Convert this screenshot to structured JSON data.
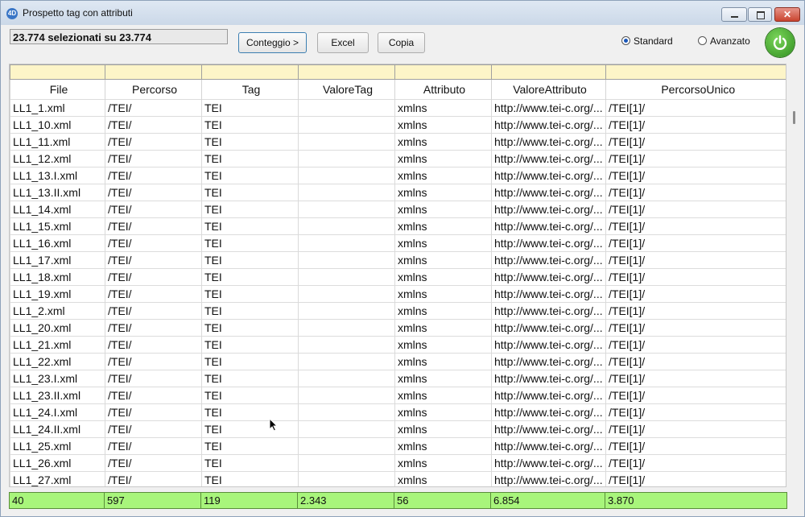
{
  "window": {
    "title": "Prospetto tag con attributi",
    "app_icon": "4D"
  },
  "toolbar": {
    "selection_text": "23.774 selezionati su 23.774",
    "count_label": "Conteggio >",
    "excel_label": "Excel",
    "copy_label": "Copia",
    "mode_standard": "Standard",
    "mode_advanced": "Avanzato",
    "selected_mode": "Standard"
  },
  "table": {
    "columns": [
      "File",
      "Percorso",
      "Tag",
      "ValoreTag",
      "Attributo",
      "ValoreAttributo",
      "PercorsoUnico"
    ],
    "rows": [
      [
        "LL1_1.xml",
        "/TEI/",
        "TEI",
        "",
        "xmlns",
        "http://www.tei-c.org/...",
        "/TEI[1]/"
      ],
      [
        "LL1_10.xml",
        "/TEI/",
        "TEI",
        "",
        "xmlns",
        "http://www.tei-c.org/...",
        "/TEI[1]/"
      ],
      [
        "LL1_11.xml",
        "/TEI/",
        "TEI",
        "",
        "xmlns",
        "http://www.tei-c.org/...",
        "/TEI[1]/"
      ],
      [
        "LL1_12.xml",
        "/TEI/",
        "TEI",
        "",
        "xmlns",
        "http://www.tei-c.org/...",
        "/TEI[1]/"
      ],
      [
        "LL1_13.I.xml",
        "/TEI/",
        "TEI",
        "",
        "xmlns",
        "http://www.tei-c.org/...",
        "/TEI[1]/"
      ],
      [
        "LL1_13.II.xml",
        "/TEI/",
        "TEI",
        "",
        "xmlns",
        "http://www.tei-c.org/...",
        "/TEI[1]/"
      ],
      [
        "LL1_14.xml",
        "/TEI/",
        "TEI",
        "",
        "xmlns",
        "http://www.tei-c.org/...",
        "/TEI[1]/"
      ],
      [
        "LL1_15.xml",
        "/TEI/",
        "TEI",
        "",
        "xmlns",
        "http://www.tei-c.org/...",
        "/TEI[1]/"
      ],
      [
        "LL1_16.xml",
        "/TEI/",
        "TEI",
        "",
        "xmlns",
        "http://www.tei-c.org/...",
        "/TEI[1]/"
      ],
      [
        "LL1_17.xml",
        "/TEI/",
        "TEI",
        "",
        "xmlns",
        "http://www.tei-c.org/...",
        "/TEI[1]/"
      ],
      [
        "LL1_18.xml",
        "/TEI/",
        "TEI",
        "",
        "xmlns",
        "http://www.tei-c.org/...",
        "/TEI[1]/"
      ],
      [
        "LL1_19.xml",
        "/TEI/",
        "TEI",
        "",
        "xmlns",
        "http://www.tei-c.org/...",
        "/TEI[1]/"
      ],
      [
        "LL1_2.xml",
        "/TEI/",
        "TEI",
        "",
        "xmlns",
        "http://www.tei-c.org/...",
        "/TEI[1]/"
      ],
      [
        "LL1_20.xml",
        "/TEI/",
        "TEI",
        "",
        "xmlns",
        "http://www.tei-c.org/...",
        "/TEI[1]/"
      ],
      [
        "LL1_21.xml",
        "/TEI/",
        "TEI",
        "",
        "xmlns",
        "http://www.tei-c.org/...",
        "/TEI[1]/"
      ],
      [
        "LL1_22.xml",
        "/TEI/",
        "TEI",
        "",
        "xmlns",
        "http://www.tei-c.org/...",
        "/TEI[1]/"
      ],
      [
        "LL1_23.I.xml",
        "/TEI/",
        "TEI",
        "",
        "xmlns",
        "http://www.tei-c.org/...",
        "/TEI[1]/"
      ],
      [
        "LL1_23.II.xml",
        "/TEI/",
        "TEI",
        "",
        "xmlns",
        "http://www.tei-c.org/...",
        "/TEI[1]/"
      ],
      [
        "LL1_24.I.xml",
        "/TEI/",
        "TEI",
        "",
        "xmlns",
        "http://www.tei-c.org/...",
        "/TEI[1]/"
      ],
      [
        "LL1_24.II.xml",
        "/TEI/",
        "TEI",
        "",
        "xmlns",
        "http://www.tei-c.org/...",
        "/TEI[1]/"
      ],
      [
        "LL1_25.xml",
        "/TEI/",
        "TEI",
        "",
        "xmlns",
        "http://www.tei-c.org/...",
        "/TEI[1]/"
      ],
      [
        "LL1_26.xml",
        "/TEI/",
        "TEI",
        "",
        "xmlns",
        "http://www.tei-c.org/...",
        "/TEI[1]/"
      ],
      [
        "LL1_27.xml",
        "/TEI/",
        "TEI",
        "",
        "xmlns",
        "http://www.tei-c.org/...",
        "/TEI[1]/"
      ]
    ],
    "totals": [
      "40",
      "597",
      "119",
      "2.343",
      "56",
      "6.854",
      "3.870"
    ]
  },
  "colors": {
    "filter_row": "#fdf5c8",
    "totals_row": "#a8f57b",
    "power_button": "#3f9f2a"
  },
  "icons": {
    "power": "power-icon",
    "cursor": "mouse-pointer-icon"
  }
}
